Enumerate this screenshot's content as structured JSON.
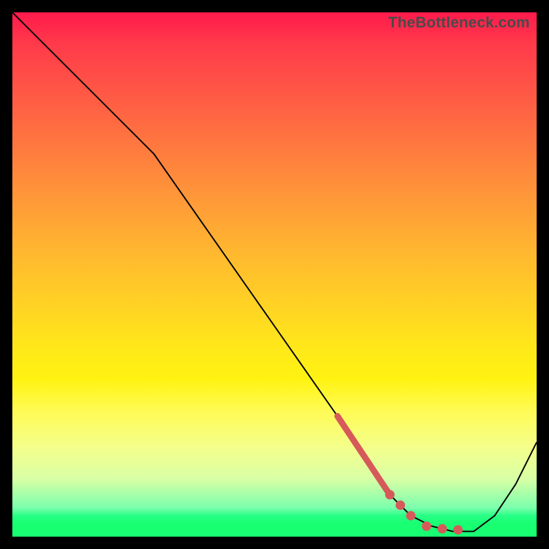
{
  "watermark": "TheBottleneck.com",
  "chart_data": {
    "type": "line",
    "title": "",
    "xlabel": "",
    "ylabel": "",
    "xlim": [
      0,
      100
    ],
    "ylim": [
      0,
      100
    ],
    "grid": false,
    "legend": false,
    "background": "rainbow-vertical",
    "series": [
      {
        "name": "bottleneck-curve",
        "stroke": "#000000",
        "x": [
          0,
          10,
          20,
          27,
          34,
          41,
          48,
          55,
          62,
          68,
          72,
          76,
          80,
          84,
          88,
          92,
          96,
          100
        ],
        "y": [
          100,
          90,
          80,
          73,
          63,
          53,
          43,
          33,
          23,
          14,
          8,
          4,
          2,
          1,
          1,
          4,
          10,
          18
        ]
      }
    ],
    "markers": {
      "name": "highlight-dots",
      "stroke": "#d65a5a",
      "fill": "#d65a5a",
      "style": "thick-dashed-segment-then-dots",
      "x": [
        62,
        64,
        66,
        68,
        70,
        72,
        74,
        76,
        79,
        82,
        85
      ],
      "y": [
        23,
        20,
        17,
        14,
        11,
        8,
        6,
        4,
        2,
        1.5,
        1.3
      ]
    }
  }
}
